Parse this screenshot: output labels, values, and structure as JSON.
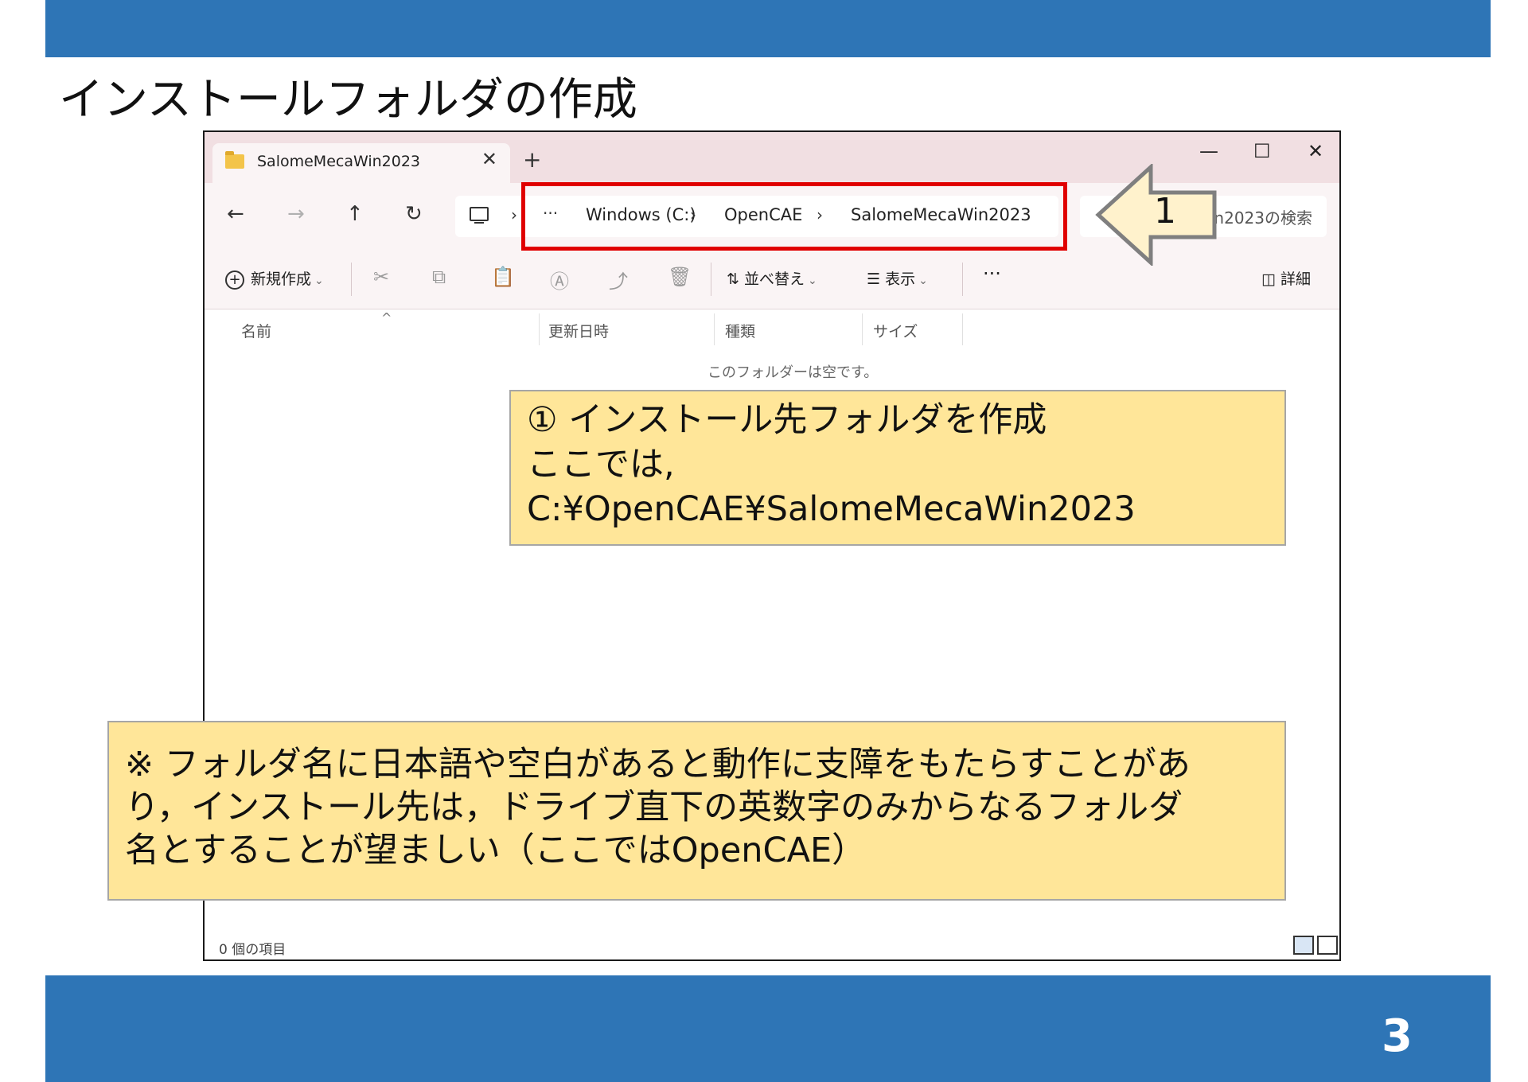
{
  "slide": {
    "title": "インストールフォルダの作成",
    "page_number": "3"
  },
  "window": {
    "tab": {
      "label": "SalomeMecaWin2023",
      "close": "✕"
    },
    "new_tab": "+",
    "controls": {
      "minimize": "—",
      "maximize": "☐",
      "close": "✕"
    },
    "nav": {
      "back": "←",
      "forward": "→",
      "up": "↑",
      "refresh": "↻"
    },
    "address": {
      "separator": "›",
      "ellipsis": "···",
      "segments": [
        "Windows (C:)",
        "OpenCAE",
        "SalomeMecaWin2023"
      ]
    },
    "search": {
      "placeholder": "Win2023の検索"
    },
    "toolbar": {
      "new": "新規作成",
      "sort": "並べ替え",
      "view": "表示",
      "more": "···",
      "details": "詳細",
      "caret": "⌄"
    },
    "columns": {
      "name": "名前",
      "modified": "更新日時",
      "type": "種類",
      "size": "サイズ"
    },
    "empty_message": "このフォルダーは空です。",
    "status": "0 個の項目"
  },
  "annotations": {
    "callout_number": "1",
    "note1": {
      "lines": [
        "① インストール先フォルダを作成",
        "ここでは,",
        "C:¥OpenCAE¥SalomeMecaWin2023"
      ]
    },
    "note2": {
      "lines": [
        "※ フォルダ名に日本語や空白があると動作に支障をもたらすことがあ",
        "り，インストール先は，ドライブ直下の英数字のみからなるフォルダ",
        "名とすることが望ましい（ここではOpenCAE）"
      ]
    }
  },
  "colors": {
    "band": "#2e75b6",
    "highlight": "#e00000",
    "note_fill": "#ffe699",
    "arrow_fill": "#fff2cc"
  }
}
